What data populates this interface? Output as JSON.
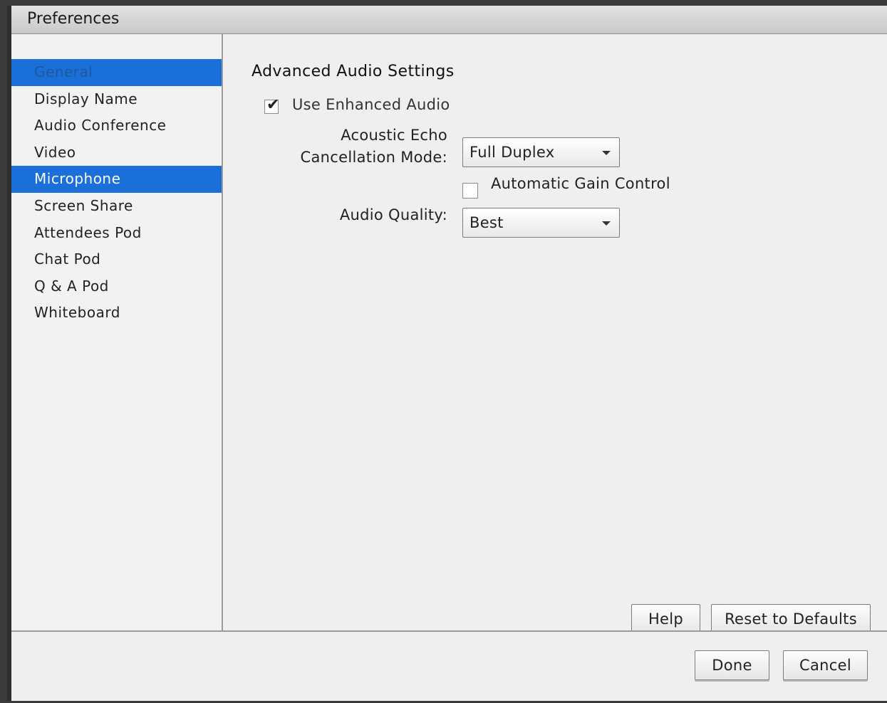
{
  "window": {
    "title": "Preferences"
  },
  "sidebar": {
    "items": [
      {
        "label": "General"
      },
      {
        "label": "Display Name"
      },
      {
        "label": "Audio Conference"
      },
      {
        "label": "Video"
      },
      {
        "label": "Microphone"
      },
      {
        "label": "Screen Share"
      },
      {
        "label": "Attendees Pod"
      },
      {
        "label": "Chat Pod"
      },
      {
        "label": "Q & A Pod"
      },
      {
        "label": "Whiteboard"
      }
    ],
    "selected": "Microphone"
  },
  "main": {
    "section_title": "Advanced Audio Settings",
    "enhanced_audio": {
      "label": "Use Enhanced Audio",
      "checked": true
    },
    "echo_mode": {
      "label_line1": "Acoustic Echo",
      "label_line2": "Cancellation Mode:",
      "value": "Full Duplex"
    },
    "gain_control": {
      "label": "Automatic Gain Control",
      "checked": false
    },
    "audio_quality": {
      "label": "Audio Quality:",
      "value": "Best"
    },
    "help_label": "Help",
    "reset_label": "Reset to Defaults"
  },
  "footer": {
    "done_label": "Done",
    "cancel_label": "Cancel"
  },
  "colors": {
    "selection": "#1a6fd8"
  }
}
